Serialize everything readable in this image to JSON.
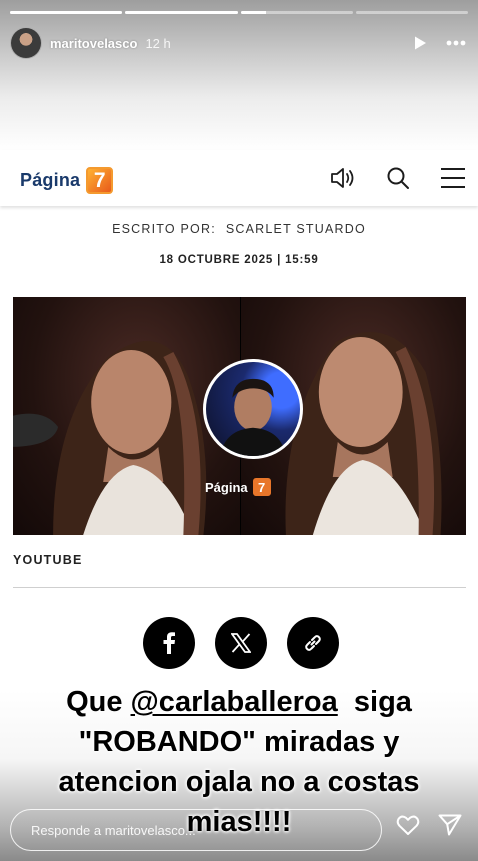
{
  "story": {
    "progress": [
      1.0,
      1.0,
      0.23,
      0.0
    ],
    "username": "maritovelasco",
    "time": "12 h"
  },
  "article": {
    "brand_text": "Página",
    "brand_number": "7",
    "byline_label": "ESCRITO POR:",
    "byline_author": "SCARLET STUARDO",
    "date": "18 OCTUBRE 2025 | 15:59",
    "watermark_text": "Página",
    "watermark_number": "7",
    "source": "YOUTUBE"
  },
  "caption": {
    "line1_prefix": "Que ",
    "line1_mention": "@carlaballeroa",
    "line1_suffix": "  siga",
    "line2": "\"ROBANDO\" miradas y",
    "line3": "atencion ojala no a costas",
    "line4": "mias!!!!"
  },
  "reply": {
    "placeholder": "Responde a maritovelasco..."
  },
  "colors": {
    "brand_blue": "#1a3a6b",
    "brand_orange": "#e8762a",
    "share_button": "#000000"
  },
  "icons": [
    "play-icon",
    "more-icon",
    "speaker-icon",
    "search-icon",
    "menu-icon",
    "facebook-icon",
    "x-icon",
    "link-icon",
    "heart-icon",
    "send-icon"
  ]
}
